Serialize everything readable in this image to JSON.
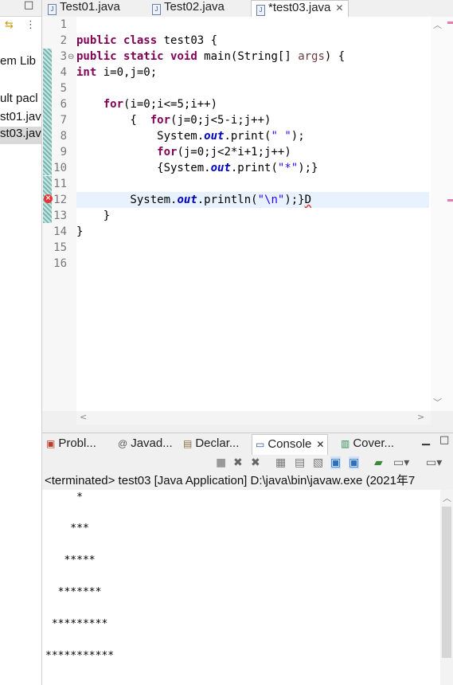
{
  "left_panel": {
    "items": [
      {
        "label": "em Lib",
        "selected": false
      },
      {
        "label": "ult pacl",
        "selected": false
      },
      {
        "label": "st01.jav",
        "selected": false
      },
      {
        "label": "st03.jav",
        "selected": true
      }
    ]
  },
  "editor": {
    "tabs": [
      {
        "label": "Test01.java",
        "active": false
      },
      {
        "label": "Test02.java",
        "active": false
      },
      {
        "label": "*test03.java",
        "active": true
      }
    ],
    "line_numbers": [
      "1",
      "2",
      "3",
      "4",
      "5",
      "6",
      "7",
      "8",
      "9",
      "10",
      "11",
      "12",
      "13",
      "14",
      "15",
      "16"
    ],
    "current_line": 12,
    "error_line": 12
  },
  "bottom_panel": {
    "tabs": [
      {
        "label": "Probl...",
        "icon": "problems-icon"
      },
      {
        "label": "Javad...",
        "icon": "javadoc-icon"
      },
      {
        "label": "Declar...",
        "icon": "declaration-icon"
      },
      {
        "label": "Console",
        "icon": "console-icon",
        "active": true
      },
      {
        "label": "Cover...",
        "icon": "coverage-icon"
      }
    ],
    "status": "<terminated> test03 [Java Application] D:\\java\\bin\\javaw.exe  (2021年7",
    "output": [
      "     *",
      "    ***",
      "   *****",
      "  *******",
      " *********",
      "***********"
    ]
  },
  "colors": {
    "keyword": "#7f0055",
    "string": "#2a00ff",
    "field": "#0000c0",
    "current_line_bg": "#e8f2fe",
    "error": "#e33333"
  }
}
